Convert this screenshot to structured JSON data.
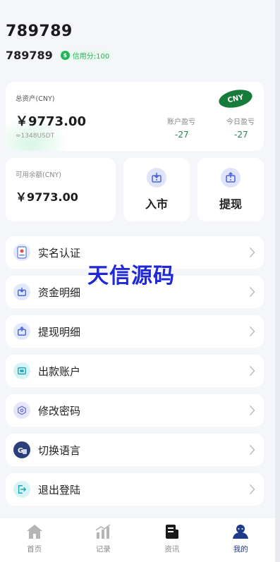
{
  "header": {
    "title": "789789",
    "username": "789789",
    "credit_label": "信用分:100"
  },
  "assets": {
    "label": "总资产(CNY)",
    "amount": "￥9773.00",
    "usdt": "≈1348USDT",
    "currency_badge": "CNY",
    "account_pl_label": "账户盈亏",
    "account_pl_value": "-27",
    "today_pl_label": "今日盈亏",
    "today_pl_value": "-27"
  },
  "available": {
    "label": "可用余额(CNY)",
    "amount": "￥9773.00"
  },
  "actions": [
    {
      "label": "入市",
      "icon": "deposit-icon"
    },
    {
      "label": "提现",
      "icon": "withdraw-icon"
    }
  ],
  "menu": [
    {
      "label": "实名认证",
      "icon": "id-card-icon"
    },
    {
      "label": "资金明细",
      "icon": "fund-detail-icon"
    },
    {
      "label": "提现明细",
      "icon": "withdraw-detail-icon"
    },
    {
      "label": "出款账户",
      "icon": "payout-account-icon"
    },
    {
      "label": "修改密码",
      "icon": "password-icon"
    },
    {
      "label": "切换语言",
      "icon": "language-icon"
    },
    {
      "label": "退出登陆",
      "icon": "logout-icon"
    }
  ],
  "watermark": "天信源码",
  "tabs": [
    {
      "label": "首页",
      "icon": "home-icon"
    },
    {
      "label": "记录",
      "icon": "records-icon"
    },
    {
      "label": "资讯",
      "icon": "news-icon"
    },
    {
      "label": "我的",
      "icon": "profile-icon"
    }
  ],
  "colors": {
    "accent": "#1e3a8a",
    "green": "#1f8a52",
    "badge_green": "#177c3b",
    "watermark": "#1f27d8"
  }
}
